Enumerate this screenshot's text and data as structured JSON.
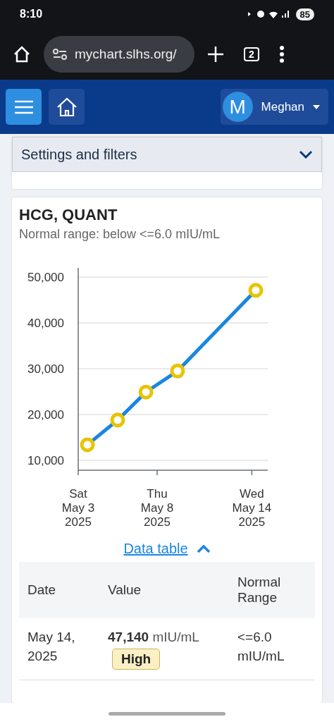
{
  "status_bar": {
    "time": "8:10",
    "battery": "85"
  },
  "browser": {
    "url": "mychart.slhs.org/",
    "tab_count": "2"
  },
  "header": {
    "avatar_letter": "M",
    "user_name": "Meghan"
  },
  "filters": {
    "title": "Settings and filters",
    "expanded": false
  },
  "result": {
    "title": "HCG, QUANT",
    "normal_range": "Normal range: below <=6.0 mIU/mL",
    "chart_data": {
      "type": "line",
      "x": [
        "2025-05-03T14:00:00Z",
        "2025-05-05T12:00:00Z",
        "2025-05-07T07:00:00Z",
        "2025-05-09T07:00:00Z",
        "2025-05-14T06:00:00Z"
      ],
      "grid": true,
      "series": [
        {
          "color": "#1a86e0",
          "marker": true,
          "values": [
            13400,
            18800,
            24900,
            29500,
            47100
          ]
        }
      ],
      "xlim": [
        "2025-05-03",
        "2025-05-15"
      ],
      "ylim": [
        8000,
        52000
      ],
      "xticks": [
        {
          "value": "2025-05-03",
          "label": "Sat May 3 2025"
        },
        {
          "value": "2025-05-08",
          "label": "Thu May 8 2025"
        },
        {
          "value": "2025-05-14",
          "label": "Wed May 14 2025"
        }
      ],
      "yticks": [
        {
          "value": 10000,
          "label": "10,000"
        },
        {
          "value": 20000,
          "label": "20,000"
        },
        {
          "value": 30000,
          "label": "30,000"
        },
        {
          "value": 40000,
          "label": "40,000"
        },
        {
          "value": 50000,
          "label": "50,000"
        }
      ]
    },
    "data_table_link": {
      "label": "Data table",
      "expanded": true
    },
    "table": {
      "columns": [
        "Date",
        "Value",
        "Normal Range"
      ],
      "rows": [
        {
          "date": "May 14, 2025",
          "value": "47,140",
          "unit": "mIU/mL",
          "flag": "High",
          "range": "<=6.0 mIU/mL"
        }
      ]
    }
  }
}
